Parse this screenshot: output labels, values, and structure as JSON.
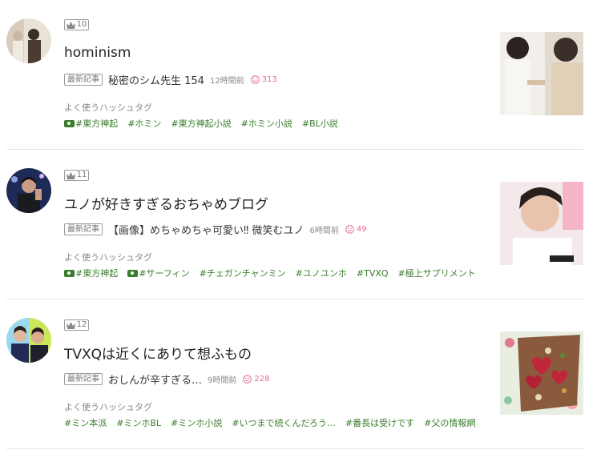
{
  "ranking": [
    {
      "rank": "10",
      "blog_title": "hominism",
      "new_label": "最新記事",
      "article_title": "秘密のシム先生 154",
      "time": "12時間前",
      "smiles": "313",
      "tags_label": "よく使うハッシュタグ",
      "tags": [
        "#東方神起",
        "#ホミン",
        "#東方神起小説",
        "#ホミン小説",
        "#BL小説"
      ]
    },
    {
      "rank": "11",
      "blog_title": "ユノが好きすぎるおちゃめブログ",
      "new_label": "最新記事",
      "article_title": "【画像】めちゃめちゃ可愛い‼ 微笑むユノ",
      "time": "6時間前",
      "smiles": "49",
      "tags_label": "よく使うハッシュタグ",
      "tags": [
        "#東方神起",
        "#サーフィン",
        "#チェガンチャンミン",
        "#ユノユンホ",
        "#TVXQ",
        "#極上サプリメント"
      ]
    },
    {
      "rank": "12",
      "blog_title": "TVXQは近くにありて想ふもの",
      "new_label": "最新記事",
      "article_title": "おしんが辛すぎる…",
      "time": "9時間前",
      "smiles": "228",
      "tags_label": "よく使うハッシュタグ",
      "tags": [
        "#ミン本派",
        "#ミンホBL",
        "#ミンホ小説",
        "#いつまで続くんだろう…",
        "#番長は受けです",
        "#父の情報網"
      ]
    }
  ],
  "colors": {
    "tag": "#3a7d2c",
    "smile": "#e5689a",
    "divider": "#e3e3e3"
  }
}
